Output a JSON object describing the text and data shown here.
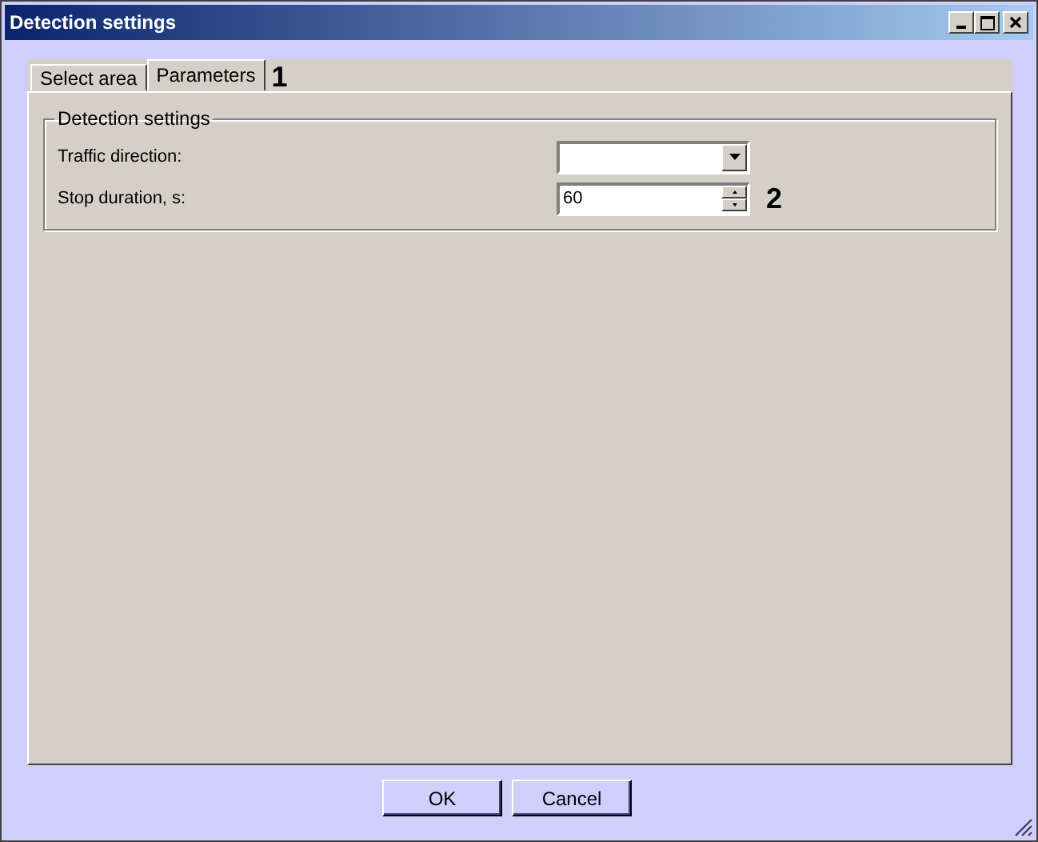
{
  "window": {
    "title": "Detection settings"
  },
  "tabs": [
    {
      "label": "Select area",
      "selected": false
    },
    {
      "label": "Parameters",
      "selected": true
    }
  ],
  "tab_callout": "1",
  "group": {
    "title": "Detection settings",
    "fields": [
      {
        "kind": "dropdown",
        "label": "Traffic direction:"
      },
      {
        "kind": "spinner",
        "label": "Stop duration, s:",
        "value": "60",
        "callout": "2"
      }
    ]
  },
  "buttons": [
    "OK",
    "Cancel"
  ]
}
